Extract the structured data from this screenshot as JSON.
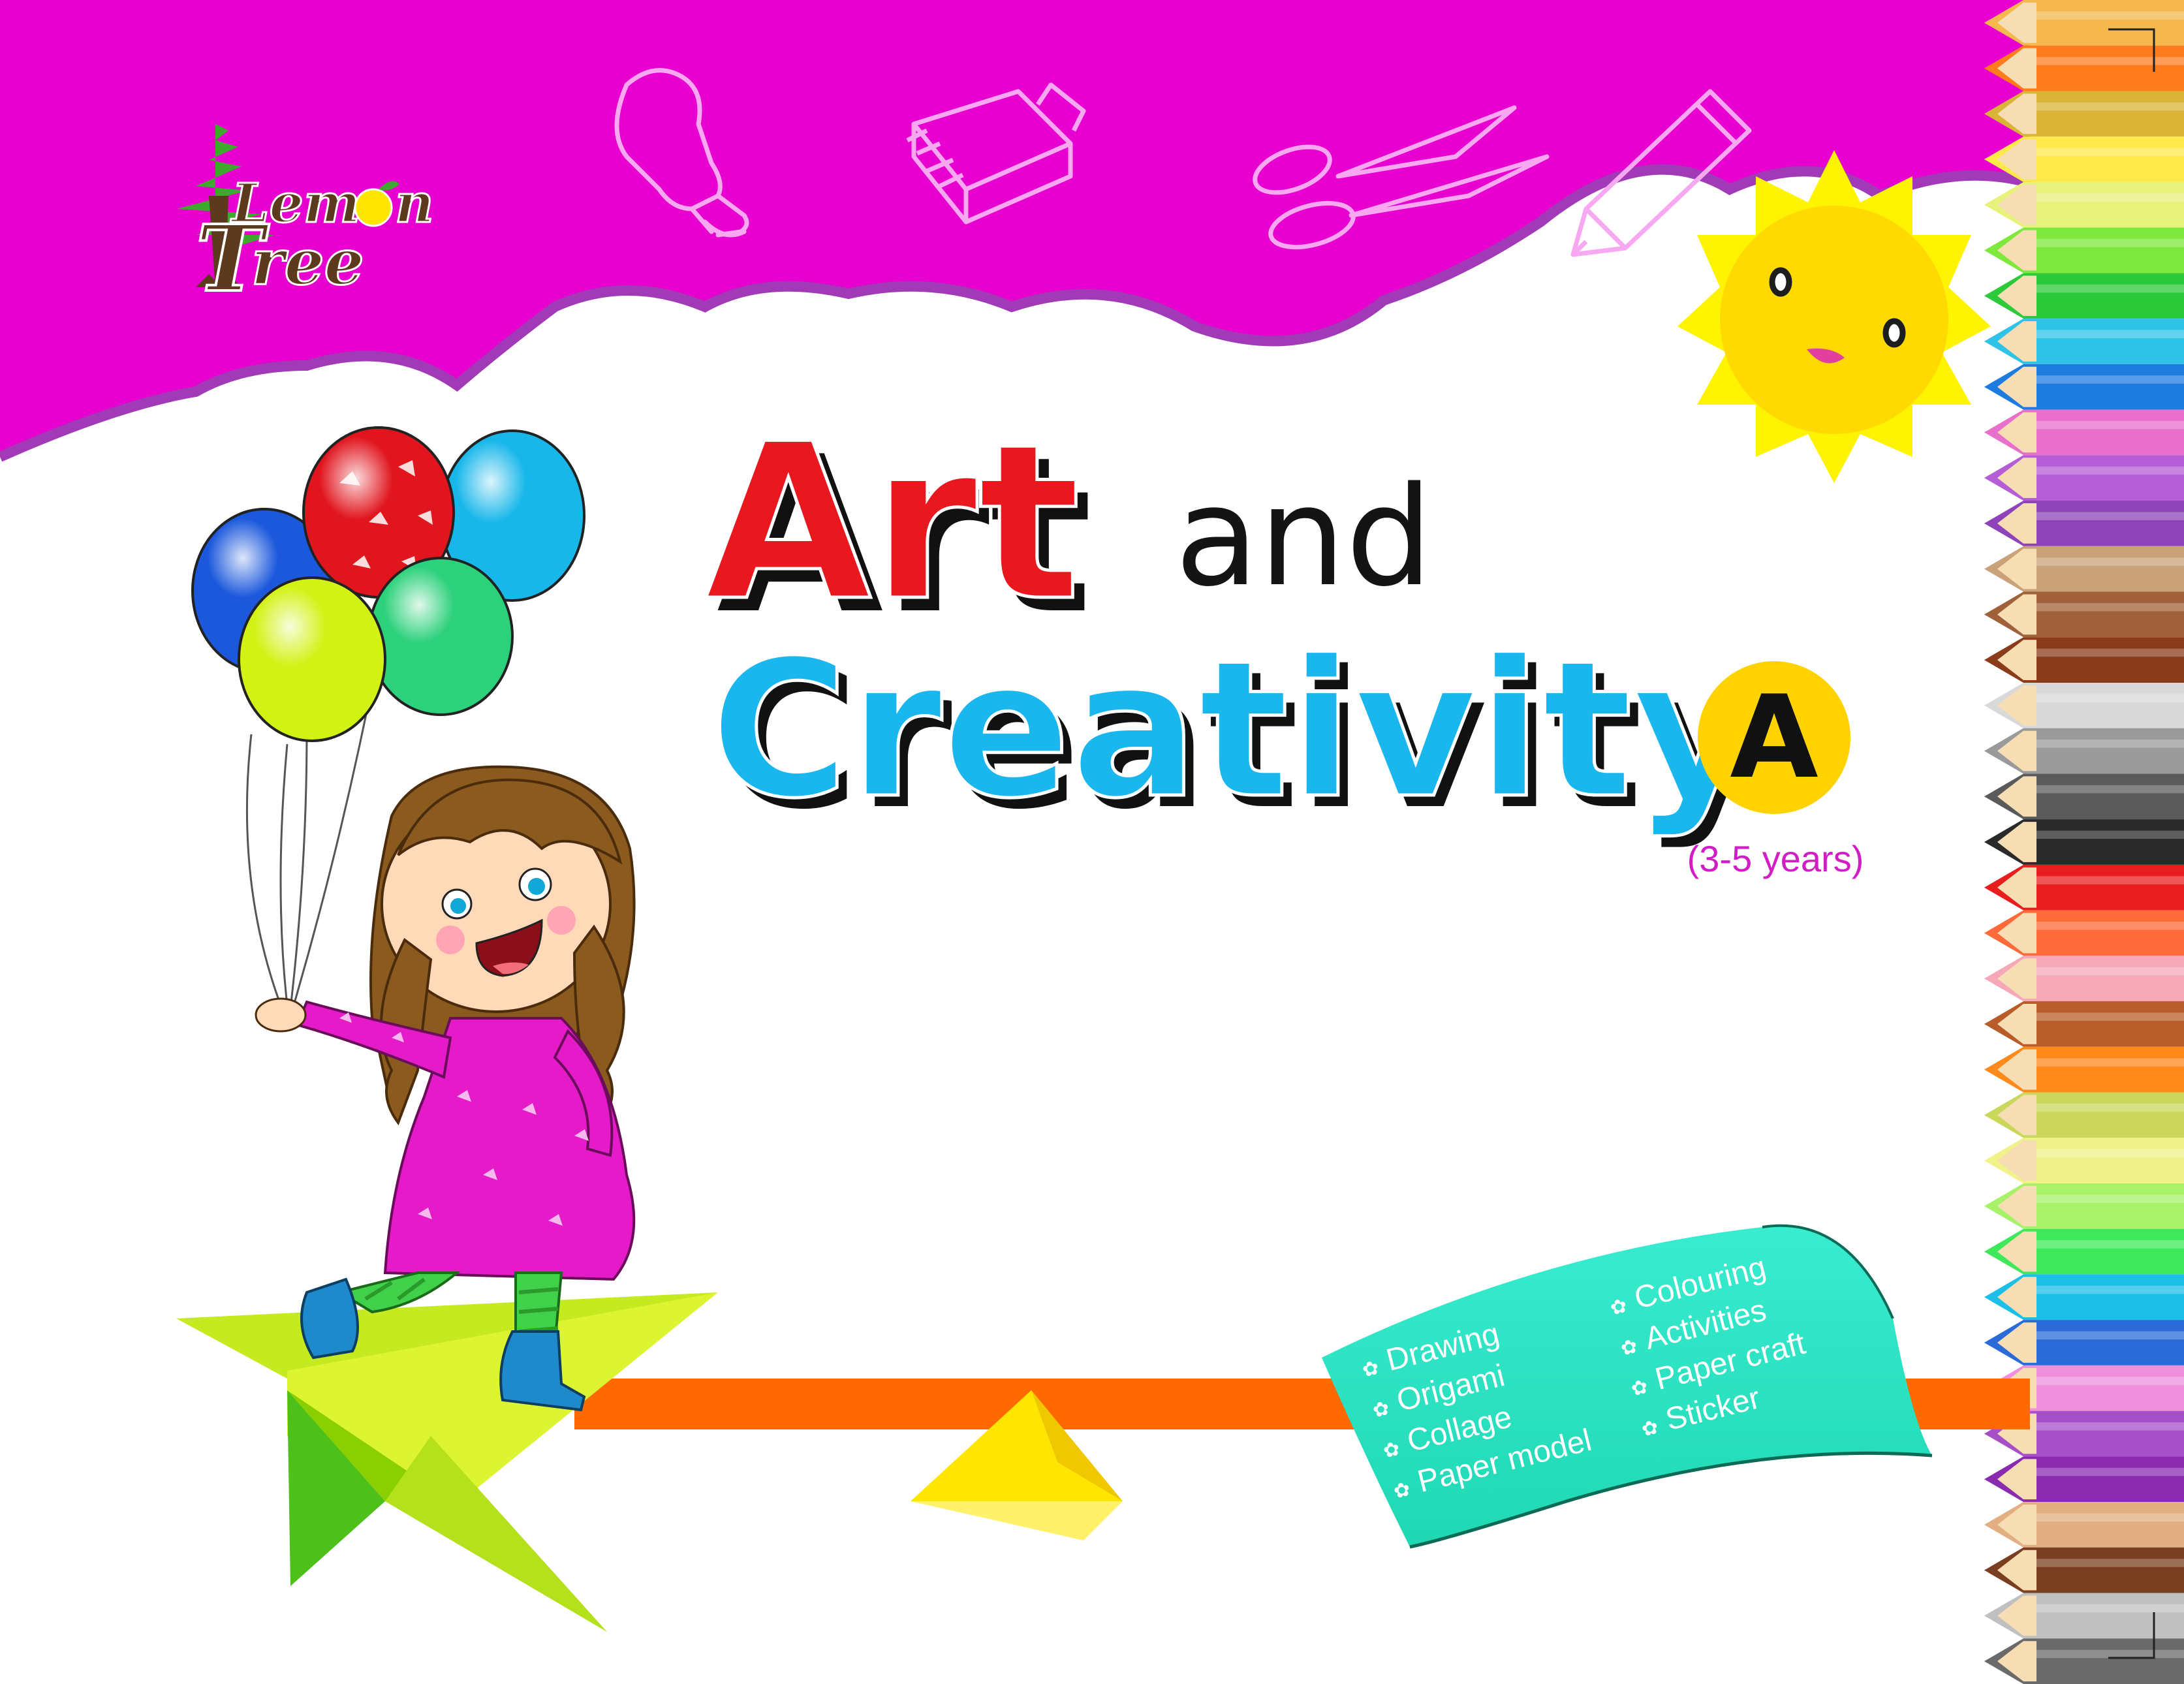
{
  "logo": {
    "word_lemon": "Lem",
    "letter_o": "o",
    "letter_n": "n",
    "word_tree": "ree",
    "letter_t": "T"
  },
  "title": {
    "art": "Art",
    "and": "and",
    "creativity": "Creativity"
  },
  "level": {
    "letter": "A",
    "age_range": "(3-5 years)"
  },
  "activities": {
    "left": [
      "Drawing",
      "Origami",
      "Collage",
      "Paper model"
    ],
    "right": [
      "Colouring",
      "Activities",
      "Paper craft",
      "Sticker"
    ]
  },
  "colors": {
    "header_magenta": "#E800D0",
    "header_border": "#A23AB8",
    "art_red": "#E8181E",
    "creativity_blue": "#1AB6EE",
    "sun_yellow": "#FFD900",
    "badge_yellow": "#FFD200",
    "age_magenta": "#D21CC6",
    "ribbon_teal": "#2FE7C5",
    "stripe_orange": "#FF6A00",
    "plane_green": "#C5EA20"
  }
}
